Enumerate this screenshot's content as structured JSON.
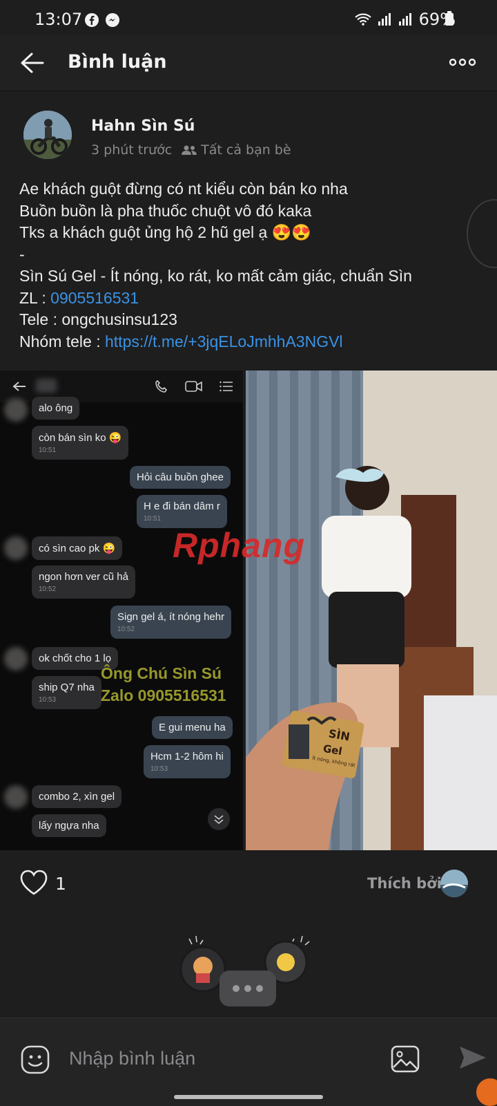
{
  "status_bar": {
    "time": "13:07",
    "battery": "69%"
  },
  "header": {
    "title": "Bình luận"
  },
  "post": {
    "author": "Hahn Sìn Sú",
    "time_ago": "3 phút trước",
    "audience": "Tất cả bạn bè",
    "lines": [
      "Ae khách guột đừng có nt kiểu còn bán ko nha",
      "Buồn buồn là pha thuốc chuột vô đó kaka",
      "Tks a khách guột ủng hộ 2 hũ gel ạ 😍😍",
      "-",
      "Sìn Sú Gel - Ít nóng, ko rát, ko mất cảm giác, chuẩn Sìn"
    ],
    "zl_label": "ZL : ",
    "zl_value": "0905516531",
    "tele_label": "Tele : ",
    "tele_value": "ongchusinsu123",
    "group_label": "Nhóm tele : ",
    "group_link": "https://t.me/+3jqELoJmhhA3NGVl"
  },
  "screenshot_chat": {
    "messages": [
      {
        "side": "left",
        "text": "alo ông",
        "time": ""
      },
      {
        "side": "left",
        "text": "còn bán sìn ko 😜",
        "time": "10:51"
      },
      {
        "side": "right",
        "text": "Hỏi câu buồn ghee",
        "time": ""
      },
      {
        "side": "right",
        "text": "H e đi bán dâm r",
        "time": "10:51"
      },
      {
        "side": "left",
        "text": "có sìn cao pk 😜",
        "time": ""
      },
      {
        "side": "left",
        "text": "ngon hơn ver cũ hả",
        "time": "10:52"
      },
      {
        "side": "right",
        "text": "Sign gel á, ít nóng hehr",
        "time": "10:52"
      },
      {
        "side": "left",
        "text": "ok chốt cho 1 lọ",
        "time": ""
      },
      {
        "side": "left",
        "text": "ship Q7 nha",
        "time": "10:53"
      },
      {
        "side": "right",
        "text": "E gui menu ha",
        "time": ""
      },
      {
        "side": "right",
        "text": "Hcm 1-2 hôm hi",
        "time": "10:53"
      },
      {
        "side": "left",
        "text": "combo 2, xìn gel",
        "time": ""
      },
      {
        "side": "left",
        "text": "lấy ngựa nha",
        "time": ""
      }
    ],
    "watermark_a": "Rphang",
    "shop_line1": "Ông Chú Sìn Sú",
    "shop_line2": "Zalo 0905516531"
  },
  "product": {
    "name1": "SÌN",
    "name2": "Gel",
    "tagline": "Ít nóng, không rát"
  },
  "reactions": {
    "count": "1",
    "liked_by": "Thích bởi"
  },
  "composer": {
    "placeholder": "Nhập bình luận"
  },
  "colors": {
    "link": "#3a93e6",
    "background": "#1e1e1f",
    "composer": "#242425"
  }
}
